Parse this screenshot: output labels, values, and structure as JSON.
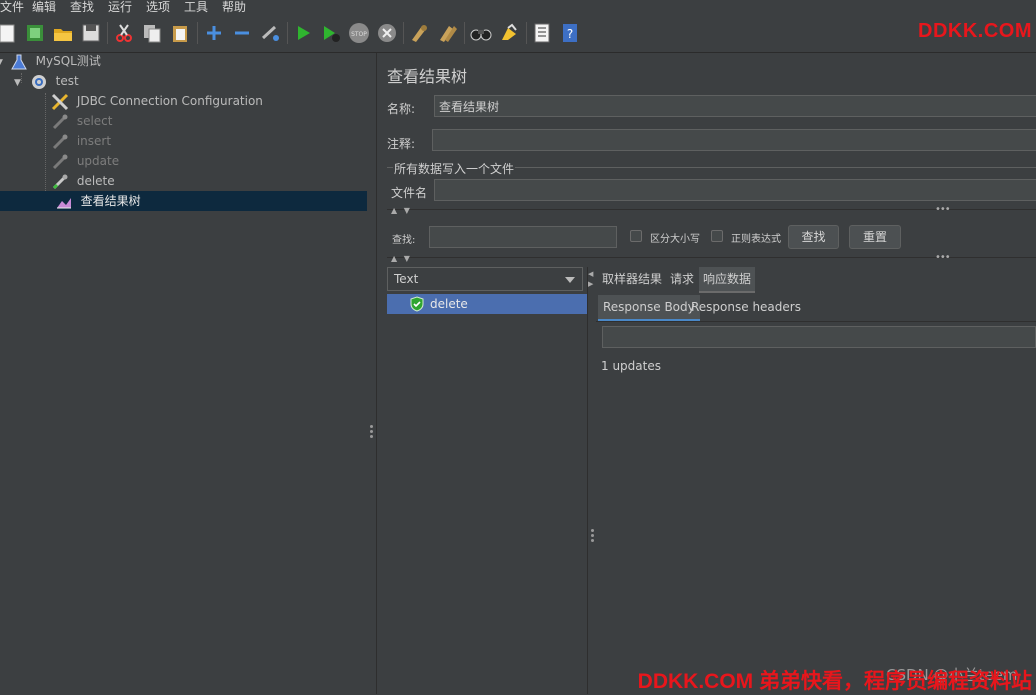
{
  "menu": [
    "文件",
    "编辑",
    "查找",
    "运行",
    "选项",
    "工具",
    "帮助"
  ],
  "brand": "DDKK.COM",
  "tree": {
    "root": "MySQL测试",
    "plan": "test",
    "items": [
      {
        "label": "JDBC Connection Configuration",
        "disabled": false
      },
      {
        "label": "select",
        "disabled": true
      },
      {
        "label": "insert",
        "disabled": true
      },
      {
        "label": "update",
        "disabled": true
      },
      {
        "label": "delete",
        "disabled": false
      },
      {
        "label": "查看结果树",
        "disabled": false,
        "selected": true
      }
    ]
  },
  "panel": {
    "title": "查看结果树",
    "name_label": "名称:",
    "name_value": "查看结果树",
    "comment_label": "注释:",
    "comment_value": "",
    "file_group": "所有数据写入一个文件",
    "file_label": "文件名",
    "file_value": "",
    "search_label": "查找:",
    "search_value": "",
    "case_label": "区分大小写",
    "regex_label": "正则表达式",
    "find_button": "查找",
    "reset_button": "重置"
  },
  "results": {
    "renderer": "Text",
    "items": [
      {
        "label": "delete",
        "status": "success"
      }
    ]
  },
  "detail": {
    "tabs": [
      "取样器结果",
      "请求",
      "响应数据"
    ],
    "active_tab": "响应数据",
    "subtabs": [
      "Response Body",
      "Response headers"
    ],
    "active_subtab": "Response Body",
    "search_value": "",
    "body_text": "1 updates"
  },
  "watermark": {
    "csdn": "CSDN @小兰teem",
    "footer": "DDKK.COM 弟弟快看，程序员编程资料站"
  }
}
